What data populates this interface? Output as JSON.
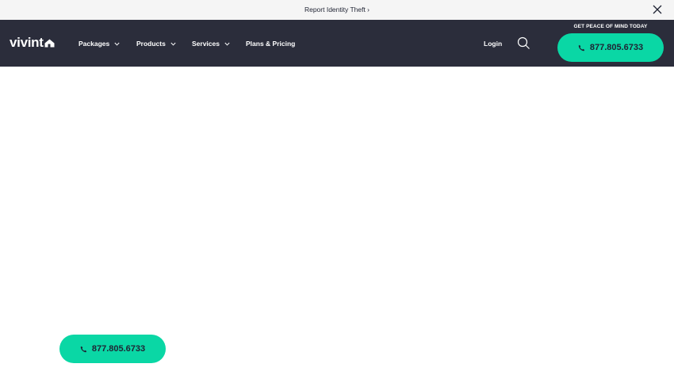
{
  "topbar": {
    "link_label": "Report Identity Theft ›",
    "close_icon": "close-icon"
  },
  "navbar": {
    "logo_text": "vivint",
    "logo_icon": "house-icon",
    "items": [
      {
        "label": "Packages",
        "has_dropdown": true
      },
      {
        "label": "Products",
        "has_dropdown": true
      },
      {
        "label": "Services",
        "has_dropdown": true
      },
      {
        "label": "Plans & Pricing",
        "has_dropdown": false
      }
    ],
    "login_label": "Login",
    "search_icon": "search-icon",
    "cta_caption": "GET PEACE OF MIND TODAY",
    "cta_phone": "877.805.6733"
  },
  "floating_cta": {
    "phone": "877.805.6733",
    "icon": "phone-icon"
  },
  "colors": {
    "topbar_bg": "#f5f5f5",
    "navbar_bg": "#2b2d3b",
    "accent": "#0ad7a5",
    "text_dark": "#1f2333"
  }
}
